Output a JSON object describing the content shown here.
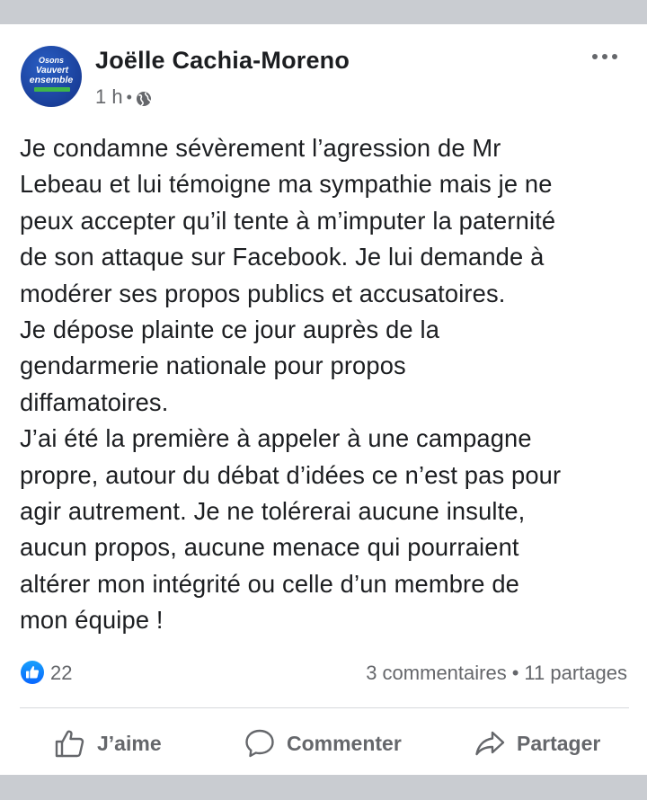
{
  "post": {
    "author": "Joëlle Cachia-Moreno",
    "time": "1 h",
    "separator": "•",
    "avatar_text": {
      "line1": "Osons",
      "line2": "Vauvert",
      "line3": "ensemble"
    },
    "text": "Je condamne sévèrement l’agression de Mr\nLebeau et lui témoigne ma sympathie mais je ne\npeux accepter qu’il tente à m’imputer la paternité\nde son attaque sur Facebook. Je lui demande à\nmodérer ses propos publics et accusatoires.\nJe dépose plainte ce jour auprès de la\ngendarmerie nationale pour propos\ndiffamatoires.\nJ’ai été la première à appeler à une campagne\npropre, autour du débat d’idées ce n’est pas pour\nagir autrement. Je ne tolérerai aucune insulte,\naucun propos, aucune menace qui pourraient\naltérer mon intégrité ou celle d’un membre de\nmon équipe !"
  },
  "stats": {
    "likes": "22",
    "comments": "3 commentaires",
    "separator": "•",
    "shares": "11 partages"
  },
  "actions": {
    "like": "J’aime",
    "comment": "Commenter",
    "share": "Partager"
  },
  "colors": {
    "brand_blue": "#1877f2",
    "avatar_blue": "#1a3f9a",
    "avatar_green": "#3fb54a",
    "text": "#1c1e21",
    "secondary_text": "#65676b",
    "frame": "#c9ccd1"
  },
  "icons": {
    "privacy": "globe-icon",
    "menu": "more-options-icon",
    "reaction": "like-reaction-icon",
    "like_action": "thumbs-up-icon",
    "comment_action": "comment-bubble-icon",
    "share_action": "share-arrow-icon"
  }
}
